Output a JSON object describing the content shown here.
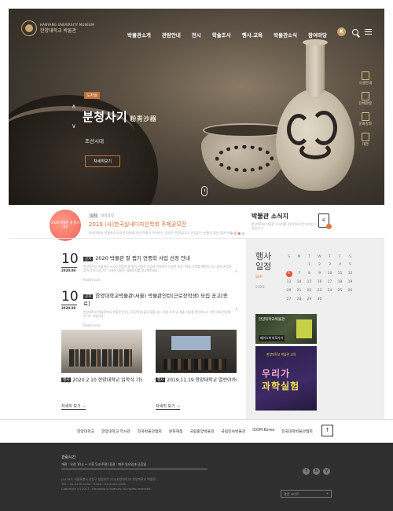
{
  "header": {
    "logo_en": "HANYANG UNIVERSITY MUSEUM",
    "logo_ko": "한양대학교 박물관",
    "nav": [
      "박물관소개",
      "관람안내",
      "전시",
      "학술조사",
      "행사.교육",
      "박물관소식",
      "참여마당"
    ],
    "badge": "K"
  },
  "hero": {
    "tag": "도자실",
    "title": "분청사기",
    "title_hanja": "粉靑沙器",
    "period": "조선시대",
    "more": "자세히보기",
    "arrow_up": "∧",
    "arrow_down": "∨"
  },
  "quick_menu": [
    "시설안내",
    "단체관람",
    "문화강좌",
    "대관"
  ],
  "notice": {
    "circle_text": "2020 박물관 잘 뵙기 대상",
    "label": "공지",
    "label2": "대외협력",
    "title": "2019 (사)한국실내디자인학회 주제공모전",
    "desc": "한양대학교 박물관과 (사)한국실내디자인학회가 주최하는 공모전 안내입니다. 관심있는 분들의 많은 참여 바랍니다."
  },
  "news_box": {
    "title": "박물관 소식지",
    "desc": "한양대학교 박물관 소식지를 온라인으로 만나보실 수 있습니다.",
    "ebook": "e"
  },
  "news": [
    {
      "day": "10",
      "ym": "2020.08",
      "cat": "공지",
      "title": "2020 박물관 잘 뵙기 연중학 사업 선정 안내",
      "preview": "한양대학교 박물관은 2020 박물관 잘 뵙기 연중학 사업에 선정되어 다양한 프로그램을 운영할 예정입니다. 많은 관심과 참여 부탁드립니다. 자세한 내용은 홈페이지를 참고해주세요.",
      "more": "Read more"
    },
    {
      "day": "10",
      "ym": "2020.08",
      "cat": "공지",
      "title": "한양대학교박물관(서울) 박물관인턴(근로장학생) 모집 공고[종료]",
      "preview": "한양대학교 박물관에서 박물관 인턴(근로장학생)을 모집합니다. 지원 자격 및 제출 서류를 확인하시고 기한 내에 신청해 주시기 바랍니다.",
      "more": "Read more"
    }
  ],
  "gallery": [
    {
      "cat": "행사",
      "title": "2020.2.10 한양대학교 입학식 기념 수...",
      "more": "자세히 보기"
    },
    {
      "cat": "행사",
      "title": "2019.11.19 한양대학교 열린아카데미4기 ...",
      "more": "자세히 보기"
    }
  ],
  "calendar": {
    "title_line1": "행사",
    "title_line2": "일정",
    "month": "SEP",
    "year": "2020",
    "days": [
      "S",
      "M",
      "T",
      "W",
      "T",
      "F",
      "S"
    ],
    "weeks": [
      [
        "",
        "",
        "1",
        "2",
        "3",
        "4",
        "5"
      ],
      [
        "6",
        "7",
        "8",
        "9",
        "10",
        "11",
        "12"
      ],
      [
        "13",
        "14",
        "15",
        "16",
        "17",
        "18",
        "19"
      ],
      [
        "20",
        "21",
        "22",
        "23",
        "24",
        "25",
        "26"
      ],
      [
        "27",
        "28",
        "29",
        "30",
        "",
        "",
        ""
      ]
    ],
    "today": "6"
  },
  "banners": {
    "b1_title": "한양대학교박물관",
    "b1_sub": "페이스북 바로가기",
    "b2_top": "한양대학교 박물관 교육",
    "b2_line1": "우리가",
    "b2_line2": "과학실험"
  },
  "links": [
    "한양대학교",
    "한양대학교 역사관",
    "한국박물관협회",
    "문화재청",
    "국립중앙박물관",
    "국립민속박물관",
    "ICOM Korea",
    "한국대학박물관협회"
  ],
  "to_top": "↑",
  "footer": {
    "title": "관람시간",
    "hours": "개관 : 오전 10시 ~ 오후 5시(주말)            휴관 : 매주 일요일과 공휴일",
    "address": "(04763) 서울특별시 성동구 왕십리로 222(한양대학교) 한양대학교 박물관",
    "tel": "TEL : 02-2220-1394~6   FAX : 02-2220-1396",
    "copy": "Copyright (c) 2017 . Hanyang University. All rights reserved.",
    "select": "관련 사이트",
    "sns": [
      "f",
      "b",
      "y"
    ]
  }
}
